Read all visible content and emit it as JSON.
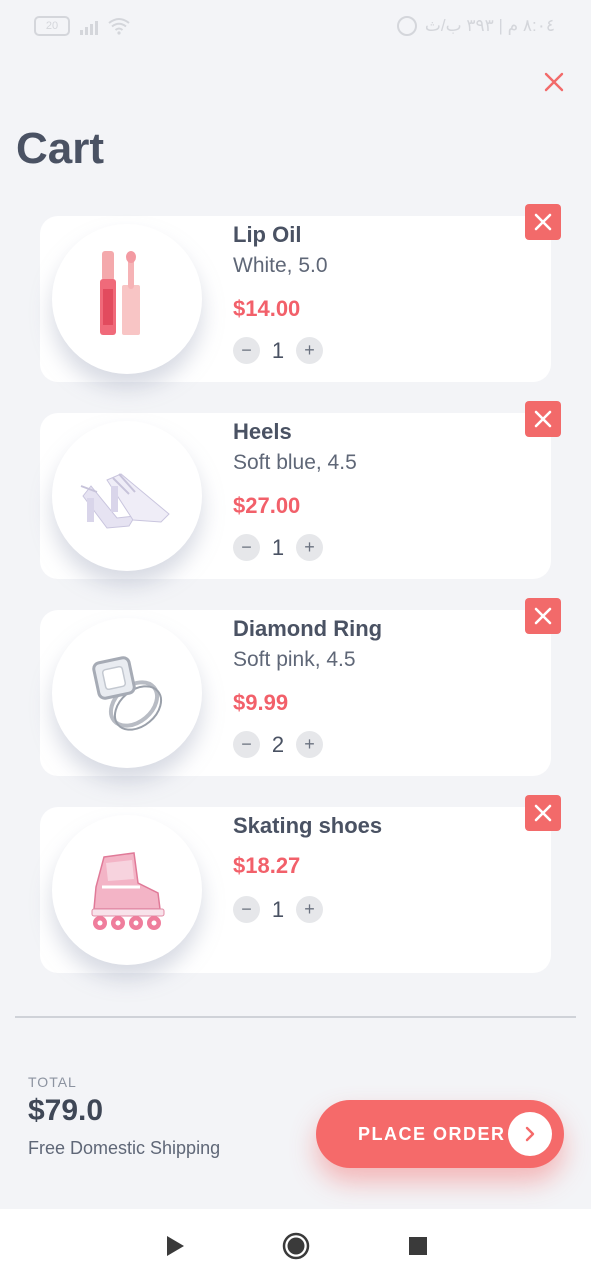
{
  "status_bar": {
    "battery": "20",
    "time_text": "٨:٠٤ م | ٣٩٣ ب/ث"
  },
  "header": {
    "title": "Cart",
    "close_icon": "close-icon"
  },
  "cart": {
    "items": [
      {
        "name": "Lip Oil",
        "variant": "White, 5.0",
        "price": "$14.00",
        "quantity": "1",
        "image": "lip-oil"
      },
      {
        "name": "Heels",
        "variant": "Soft blue, 4.5",
        "price": "$27.00",
        "quantity": "1",
        "image": "heels"
      },
      {
        "name": "Diamond Ring",
        "variant": "Soft pink, 4.5",
        "price": "$9.99",
        "quantity": "2",
        "image": "ring"
      },
      {
        "name": "Skating shoes",
        "variant": "",
        "price": "$18.27",
        "quantity": "1",
        "image": "skates"
      }
    ],
    "qty_minus": "−",
    "qty_plus": "+"
  },
  "summary": {
    "total_label": "TOTAL",
    "total_value": "$79.0",
    "shipping_note": "Free Domestic Shipping",
    "place_order_label": "PLACE ORDER"
  },
  "colors": {
    "accent": "#f56a6a",
    "price": "#f2606a",
    "background": "#f3f4f7",
    "text": "#4a5263"
  },
  "nav": {
    "back_icon": "back-triangle-icon",
    "home_icon": "home-circle-icon",
    "recents_icon": "recents-square-icon"
  }
}
